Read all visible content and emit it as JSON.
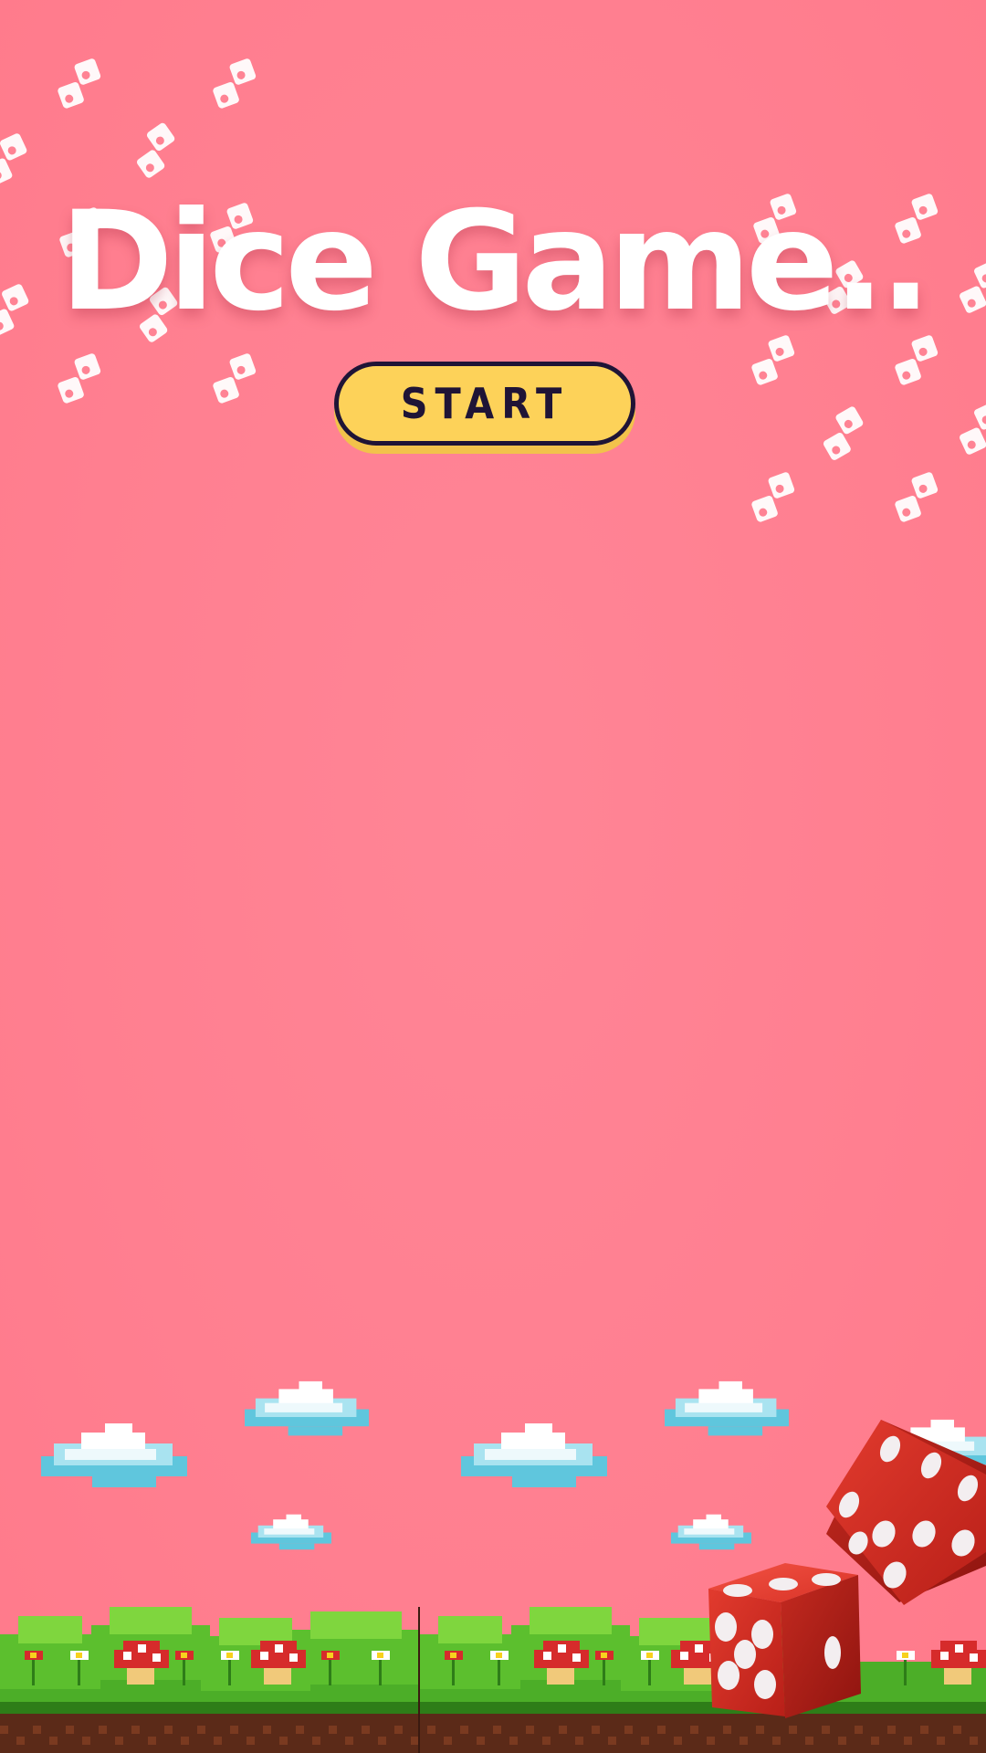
{
  "title": "Dice Game..",
  "start_label": "START",
  "colors": {
    "background": "#ff7f90",
    "button_fill": "#fdd259",
    "button_border": "#1f1436",
    "title": "#ffffff",
    "die_red": "#d93327"
  },
  "icons": [
    "scattered-dice-icon",
    "pixel-cloud-icon",
    "pixel-mushroom-icon",
    "red-die-icon"
  ]
}
